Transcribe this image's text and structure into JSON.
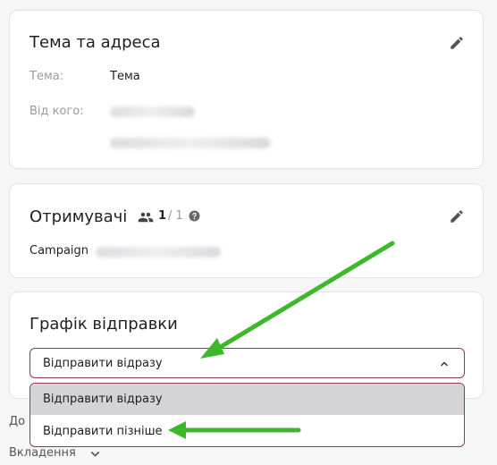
{
  "subject_card": {
    "title": "Тема та адреса",
    "subject_label": "Тема:",
    "subject_value": "Тема",
    "from_label": "Від кого:"
  },
  "recipients_card": {
    "title": "Отримувачі",
    "count_active": "1",
    "count_sep_total": "/ 1",
    "campaign_label": "Campaign"
  },
  "schedule_card": {
    "title": "Графік відправки",
    "selected_value": "Відправити відразу",
    "options": [
      "Відправити відразу",
      "Відправити пізніше"
    ]
  },
  "bottom": {
    "truncated_label": "До",
    "attachments_label": "Вкладення"
  },
  "colors": {
    "focus_border": "#8e3a4f",
    "arrow_green": "#3db82a",
    "selected_option_bg": "#d4d4d8"
  },
  "icons": {
    "edit": "pencil-icon",
    "people": "people-icon",
    "help": "help-circle-icon",
    "chevron_up": "chevron-up-icon",
    "chevron_down": "chevron-down-icon"
  }
}
